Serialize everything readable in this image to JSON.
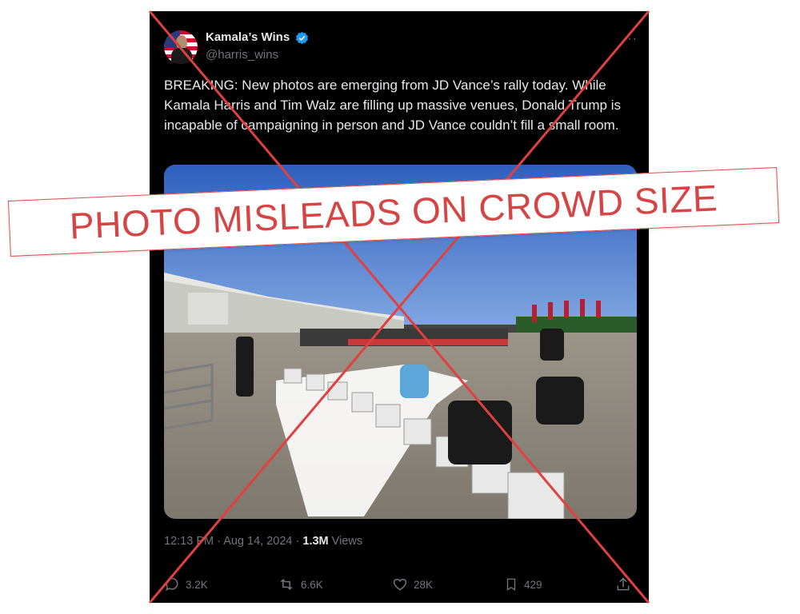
{
  "tweet": {
    "author_name": "Kamala’s Wins",
    "author_handle": "@harris_wins",
    "verified": true,
    "more_menu": "···",
    "text": "BREAKING: New photos are emerging from JD Vance’s rally today. While Kamala Harris and Tim Walz are filling up massive venues, Donald Trump is incapable of campaigning in person and JD Vance couldn’t fill a small room.",
    "time": "12:13 PM",
    "date": "Aug 14, 2024",
    "separator": "·",
    "views_count": "1.3M",
    "views_label": "Views",
    "actions": {
      "replies": "3.2K",
      "reposts": "6.6K",
      "likes": "28K",
      "bookmarks": "429"
    }
  },
  "overlay": {
    "stamp_text": "PHOTO MISLEADS ON CROWD SIZE",
    "stamp_color": "#d64545",
    "cross_color": "#e04040"
  },
  "colors": {
    "background": "#000000",
    "text_primary": "#e7e9ea",
    "text_secondary": "#71767b",
    "verified_blue": "#1d9bf0"
  }
}
